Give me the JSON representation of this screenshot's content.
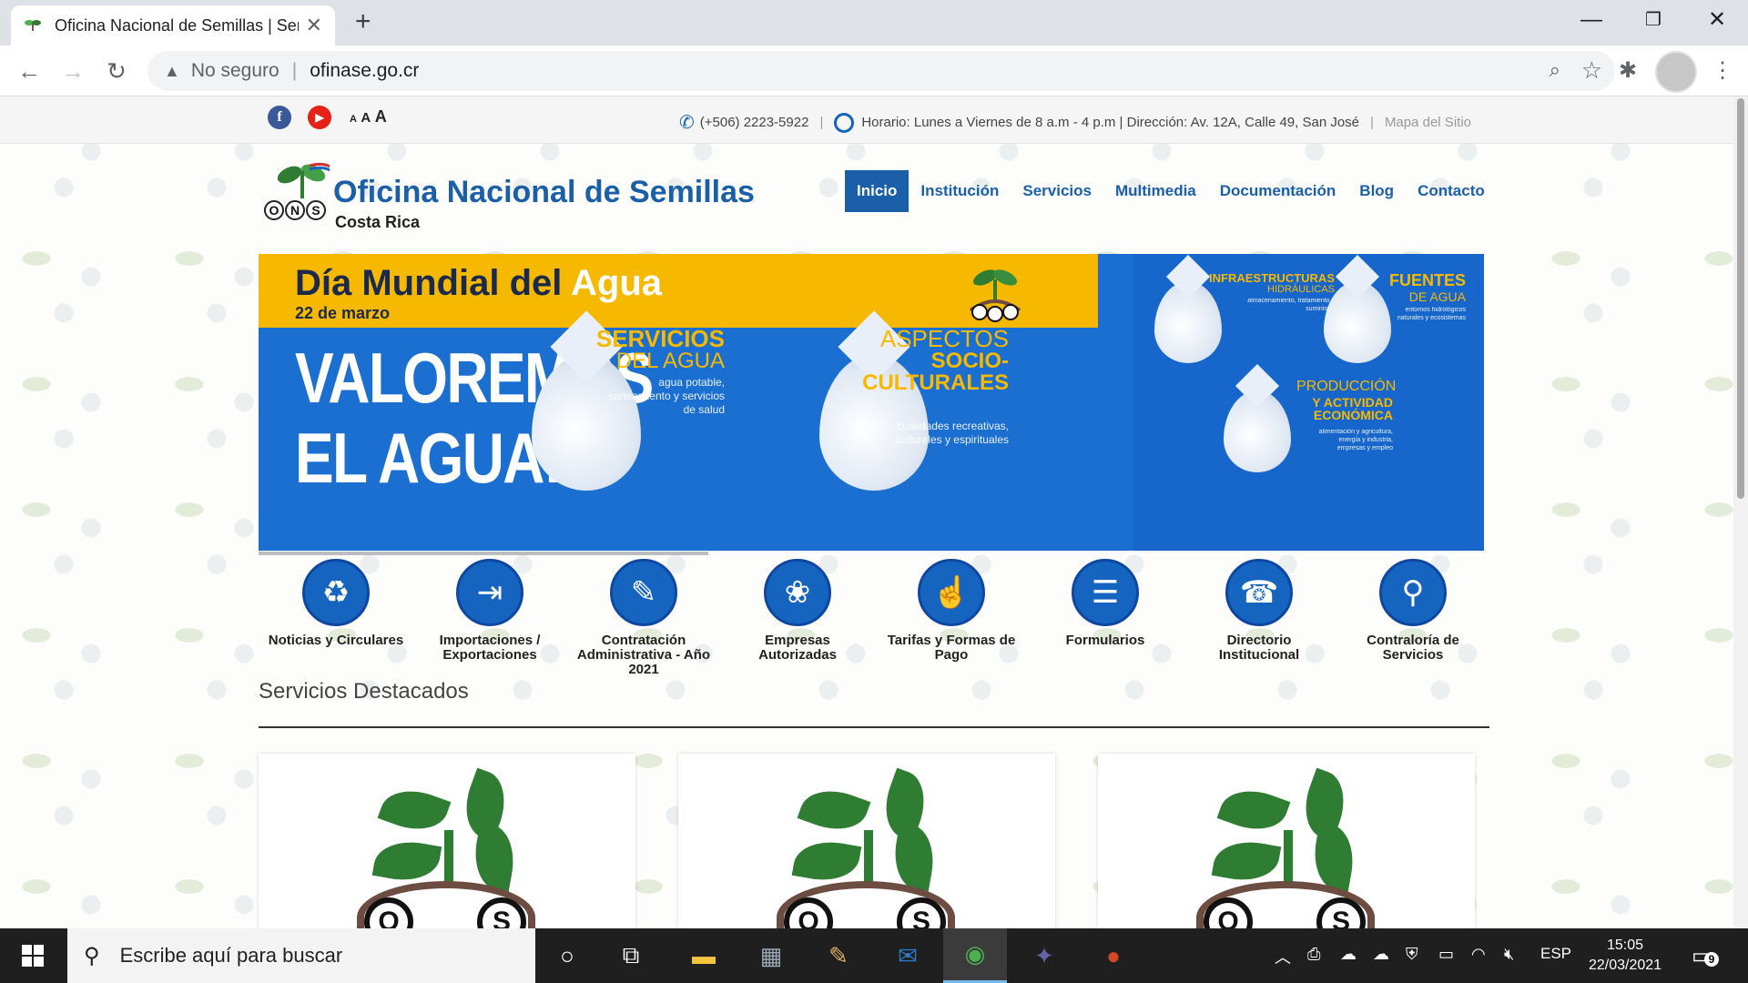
{
  "browser": {
    "tab_title": "Oficina Nacional de Semillas | Ser",
    "new_tab": "+",
    "security_label": "No seguro",
    "url": "ofinase.go.cr"
  },
  "topbar": {
    "font_size_small": "A",
    "font_size_medium": "A",
    "font_size_large": "A",
    "phone": "(+506) 2223-5922",
    "schedule": "Horario: Lunes a Viernes de 8 a.m - 4 p.m | Dirección: Av. 12A, Calle 49, San José",
    "sitemap": "Mapa del Sitio"
  },
  "header": {
    "org_name": "Oficina Nacional de Semillas",
    "country": "Costa Rica",
    "logo_letters": [
      "O",
      "N",
      "S"
    ],
    "nav": [
      {
        "label": "Inicio",
        "active": true
      },
      {
        "label": "Institución"
      },
      {
        "label": "Servicios"
      },
      {
        "label": "Multimedia"
      },
      {
        "label": "Documentación"
      },
      {
        "label": "Blog"
      },
      {
        "label": "Contacto"
      }
    ]
  },
  "banner": {
    "title_dark": "Día Mundial del",
    "title_light": "Agua",
    "date": "22 de marzo",
    "headline_line1": "VALOREMOS",
    "headline_line2": "EL AGUA:",
    "items": [
      {
        "title1": "SERVICIOS",
        "title2": "DEL AGUA",
        "desc": "agua potable, saneamiento y servicios de salud"
      },
      {
        "title1": "ASPECTOS",
        "title2": "SOCIO- CULTURALES",
        "desc": "cualidades recreativas, culturales y espirituales"
      },
      {
        "title1": "INFRAESTRUCTURAS",
        "title2": "HIDRÁULICAS",
        "desc": "almacenamiento, tratamiento y suministro"
      },
      {
        "title1": "FUENTES",
        "title2": "DE AGUA",
        "desc": "entornos hidrológicos naturales y ecosistemas"
      },
      {
        "title1": "PRODUCCIÓN",
        "title2": "Y ACTIVIDAD ECONÓMICA",
        "desc": "alimentación y agricultura, energía y industria, empresas y empleo"
      }
    ],
    "colors": {
      "blue": "#1b6fd1",
      "yellow": "#f7b800"
    }
  },
  "quick_links": [
    {
      "label": "Noticias y Circulares",
      "icon": "recycle-people-icon"
    },
    {
      "label": "Importaciones / Exportaciones",
      "icon": "import-export-icon"
    },
    {
      "label": "Contratación Administrativa - Año 2021",
      "icon": "contract-edit-icon"
    },
    {
      "label": "Empresas Autorizadas",
      "icon": "seed-bag-icon"
    },
    {
      "label": "Tarifas y Formas de Pago",
      "icon": "hand-pay-icon"
    },
    {
      "label": "Formularios",
      "icon": "document-icon"
    },
    {
      "label": "Directorio Institucional",
      "icon": "phone-book-icon"
    },
    {
      "label": "Contraloría de Servicios",
      "icon": "location-pin-icon"
    }
  ],
  "featured": {
    "title": "Servicios Destacados",
    "cards": [
      {
        "logo_letters": [
          "O",
          "S"
        ]
      },
      {
        "logo_letters": [
          "O",
          "S"
        ]
      },
      {
        "logo_letters": [
          "O",
          "S"
        ]
      }
    ]
  },
  "taskbar": {
    "search_placeholder": "Escribe aquí para buscar",
    "language": "ESP",
    "time": "15:05",
    "date": "22/03/2021",
    "notification_count": "9"
  }
}
